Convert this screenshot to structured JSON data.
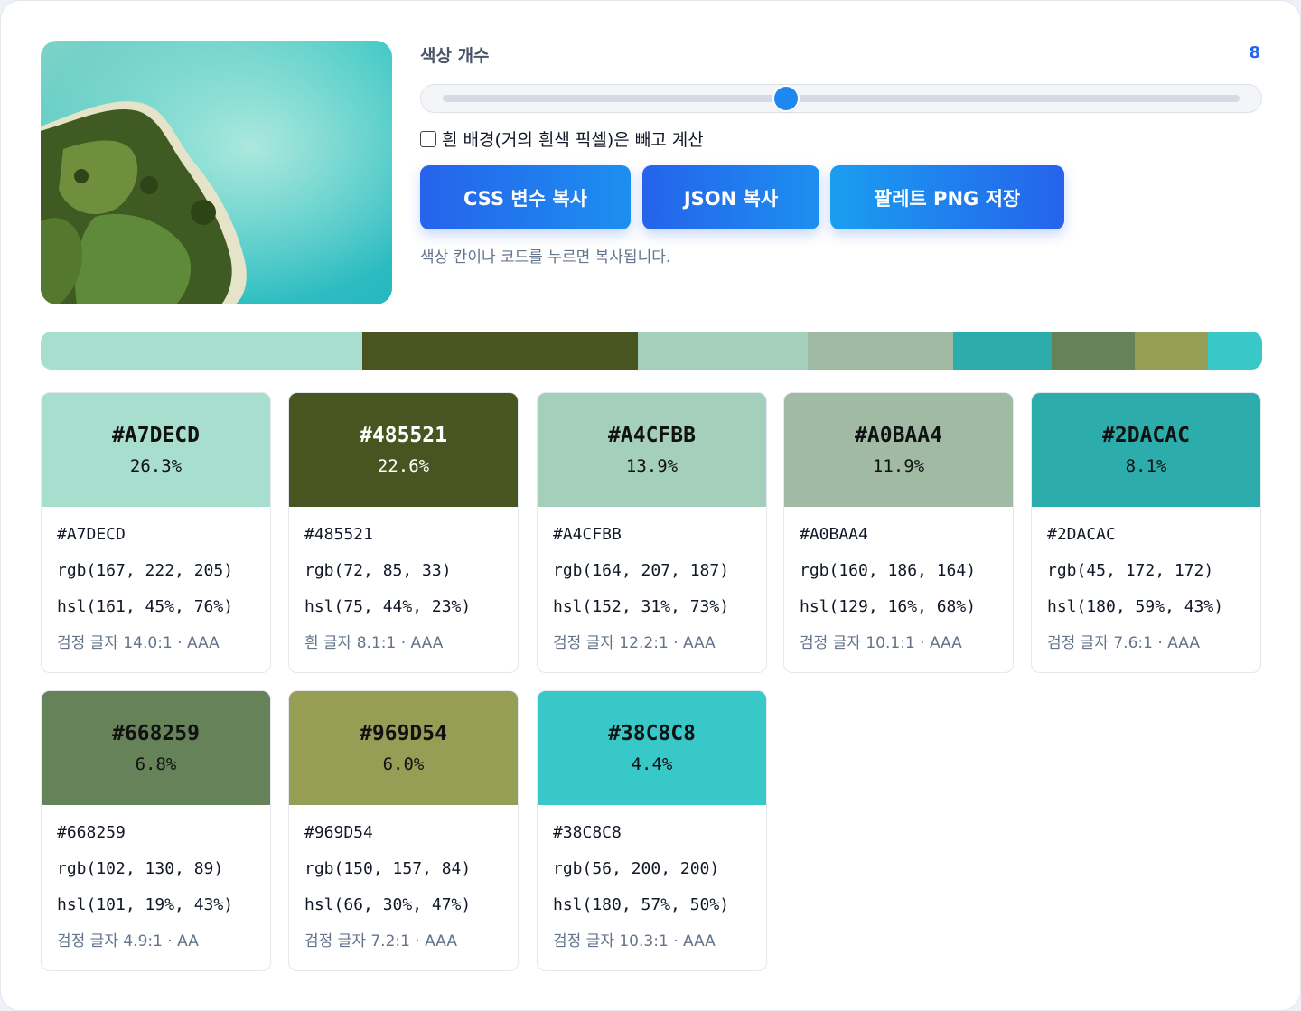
{
  "controls": {
    "count_label": "색상 개수",
    "count_value": "8",
    "slider_value": 0.43,
    "checkbox_label": "흰 배경(거의 흰색 픽셀)은 빼고 계산",
    "checkbox_checked": false,
    "buttons": {
      "css": "CSS 변수 복사",
      "json": "JSON 복사",
      "png": "팔레트 PNG 저장"
    },
    "hint": "색상 칸이나 코드를 누르면 복사됩니다."
  },
  "palette": [
    {
      "hex": "#A7DECD",
      "pct": "26.3%",
      "share": 26.3,
      "rgb": "rgb(167, 222, 205)",
      "hsl": "hsl(161, 45%, 76%)",
      "contrast": "검정 글자 14.0:1 · AAA",
      "text_color": "#111111"
    },
    {
      "hex": "#485521",
      "pct": "22.6%",
      "share": 22.6,
      "rgb": "rgb(72, 85, 33)",
      "hsl": "hsl(75, 44%, 23%)",
      "contrast": "흰 글자 8.1:1 · AAA",
      "text_color": "#ffffff"
    },
    {
      "hex": "#A4CFBB",
      "pct": "13.9%",
      "share": 13.9,
      "rgb": "rgb(164, 207, 187)",
      "hsl": "hsl(152, 31%, 73%)",
      "contrast": "검정 글자 12.2:1 · AAA",
      "text_color": "#111111"
    },
    {
      "hex": "#A0BAA4",
      "pct": "11.9%",
      "share": 11.9,
      "rgb": "rgb(160, 186, 164)",
      "hsl": "hsl(129, 16%, 68%)",
      "contrast": "검정 글자 10.1:1 · AAA",
      "text_color": "#111111"
    },
    {
      "hex": "#2DACAC",
      "pct": "8.1%",
      "share": 8.1,
      "rgb": "rgb(45, 172, 172)",
      "hsl": "hsl(180, 59%, 43%)",
      "contrast": "검정 글자 7.6:1 · AAA",
      "text_color": "#111111"
    },
    {
      "hex": "#668259",
      "pct": "6.8%",
      "share": 6.8,
      "rgb": "rgb(102, 130, 89)",
      "hsl": "hsl(101, 19%, 43%)",
      "contrast": "검정 글자 4.9:1 · AA",
      "text_color": "#111111"
    },
    {
      "hex": "#969D54",
      "pct": "6.0%",
      "share": 6.0,
      "rgb": "rgb(150, 157, 84)",
      "hsl": "hsl(66, 30%, 47%)",
      "contrast": "검정 글자 7.2:1 · AAA",
      "text_color": "#111111"
    },
    {
      "hex": "#38C8C8",
      "pct": "4.4%",
      "share": 4.4,
      "rgb": "rgb(56, 200, 200)",
      "hsl": "hsl(180, 57%, 50%)",
      "contrast": "검정 글자 10.3:1 · AAA",
      "text_color": "#111111"
    }
  ]
}
